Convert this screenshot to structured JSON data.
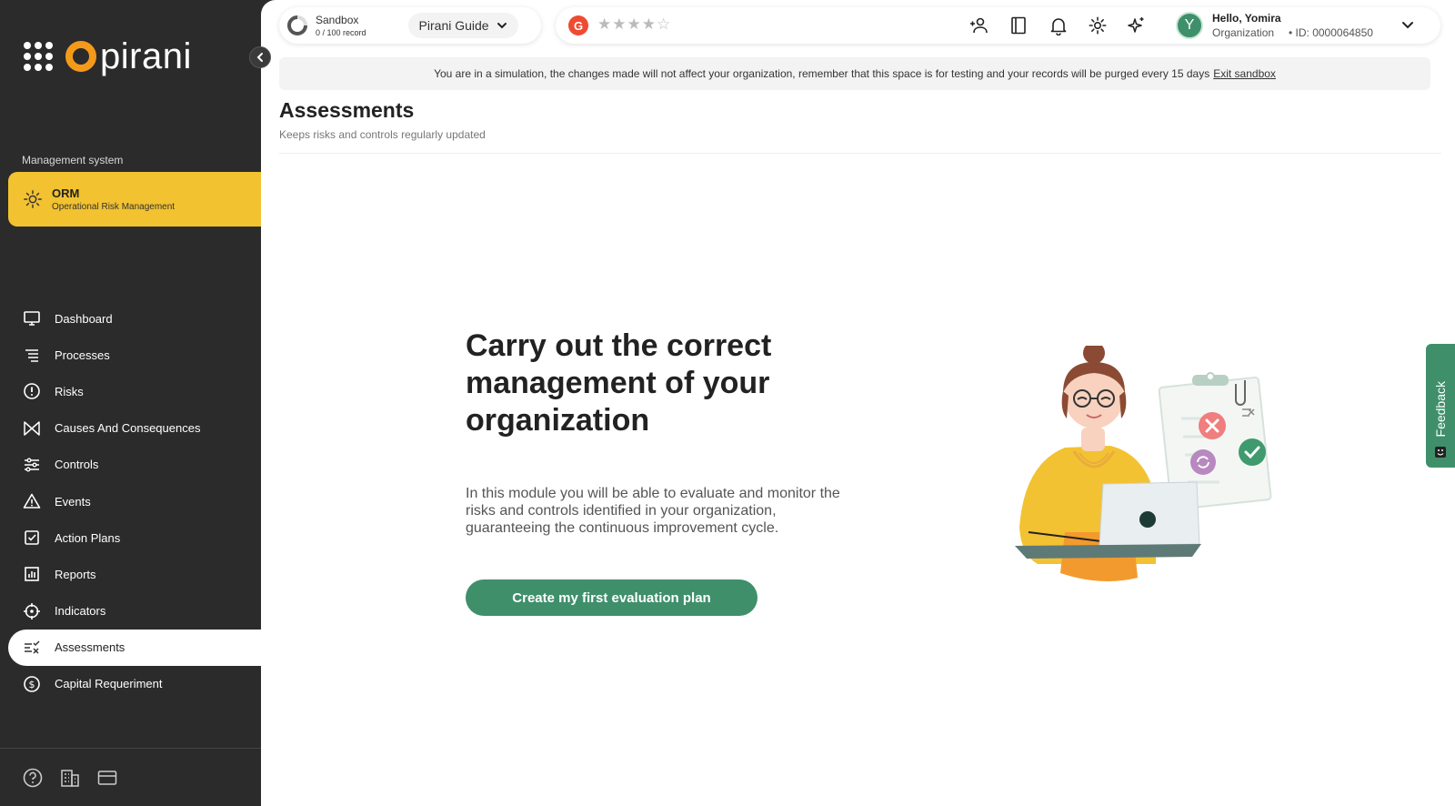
{
  "sidebar": {
    "logo_text": "pirani",
    "section_label": "Management system",
    "module": {
      "title": "ORM",
      "subtitle": "Operational Risk Management"
    },
    "items": [
      {
        "label": "Dashboard",
        "icon": "monitor-icon"
      },
      {
        "label": "Processes",
        "icon": "list-icon"
      },
      {
        "label": "Risks",
        "icon": "alert-circle-icon"
      },
      {
        "label": "Causes And Consequences",
        "icon": "bowtie-icon"
      },
      {
        "label": "Controls",
        "icon": "sliders-icon"
      },
      {
        "label": "Events",
        "icon": "warning-triangle-icon"
      },
      {
        "label": "Action Plans",
        "icon": "checkbox-icon"
      },
      {
        "label": "Reports",
        "icon": "bar-chart-icon"
      },
      {
        "label": "Indicators",
        "icon": "crosshair-icon"
      },
      {
        "label": "Assessments",
        "icon": "checklist-icon",
        "active": true
      },
      {
        "label": "Capital Requeriment",
        "icon": "dollar-circle-icon"
      }
    ]
  },
  "header": {
    "sandbox_title": "Sandbox",
    "sandbox_records": "0 / 100 record",
    "guide_label": "Pirani Guide",
    "g2_label": "G",
    "stars": "★★★★☆",
    "user_avatar": "Y",
    "user_greeting": "Hello, Yomira",
    "user_org": "Organization",
    "user_id": "• ID: 0000064850"
  },
  "banner": {
    "text": "You are in a simulation, the changes made will not affect your organization, remember that this space is for testing and your records will be purged every 15 days",
    "link": "Exit sandbox"
  },
  "page": {
    "title": "Assessments",
    "subtitle": "Keeps risks and controls regularly updated",
    "hero_title": "Carry out the correct management of your organization",
    "hero_desc": "In this module you will be able to evaluate and monitor the risks and controls identified in your organization, guaranteeing the continuous improvement cycle.",
    "cta": "Create my first evaluation plan"
  },
  "feedback_label": "Feedback",
  "colors": {
    "accent_green": "#3f8f6b",
    "orm_yellow": "#f2c230",
    "sidebar_bg": "#2b2b2b",
    "logo_orange": "#f49a1a"
  }
}
